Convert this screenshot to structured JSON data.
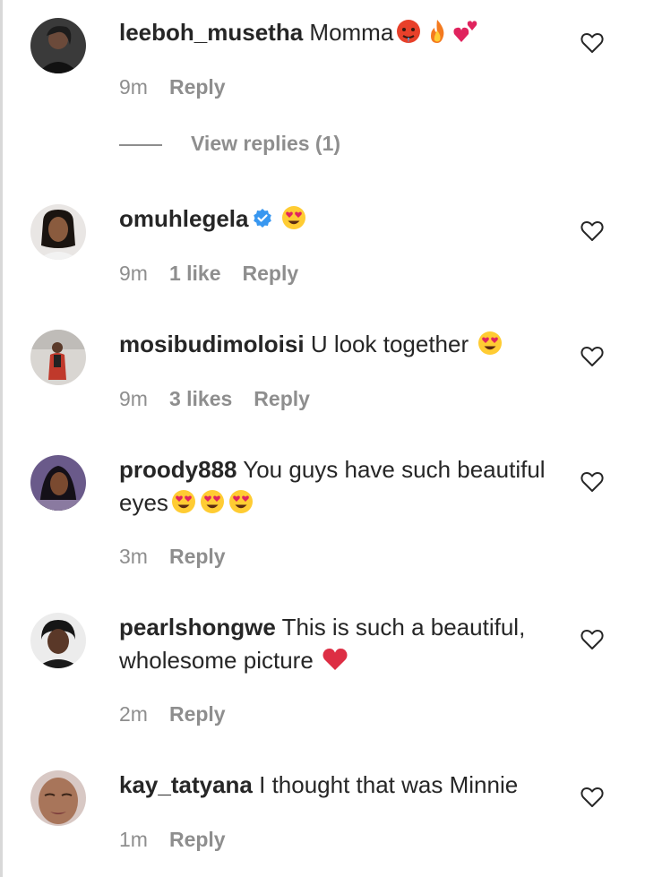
{
  "comments": [
    {
      "username": "leeboh_musetha",
      "text": "Momma",
      "emojis": [
        "hot-face-emoji",
        "fire-emoji",
        "two-hearts-emoji"
      ],
      "time": "9m",
      "likes": "",
      "reply": "Reply",
      "view_replies": "View replies (1)"
    },
    {
      "username": "omuhlegela",
      "verified": true,
      "text": "",
      "emojis": [
        "heart-eyes-emoji"
      ],
      "time": "9m",
      "likes": "1 like",
      "reply": "Reply"
    },
    {
      "username": "mosibudimoloisi",
      "text": "U look together",
      "emojis": [
        "heart-eyes-emoji"
      ],
      "time": "9m",
      "likes": "3 likes",
      "reply": "Reply"
    },
    {
      "username": "proody888",
      "text": "You guys have such beautiful eyes",
      "emojis": [
        "heart-eyes-emoji",
        "heart-eyes-emoji",
        "heart-eyes-emoji"
      ],
      "time": "3m",
      "likes": "",
      "reply": "Reply"
    },
    {
      "username": "pearlshongwe",
      "text": "This is such a beautiful, wholesome picture",
      "emojis": [
        "red-heart-emoji"
      ],
      "time": "2m",
      "likes": "",
      "reply": "Reply"
    },
    {
      "username": "kay_tatyana",
      "text": "I thought that was Minnie",
      "emojis": [],
      "time": "1m",
      "likes": "",
      "reply": "Reply"
    }
  ],
  "colors": {
    "text": "#262626",
    "muted": "#8e8e8e",
    "verified": "#3897f0"
  }
}
